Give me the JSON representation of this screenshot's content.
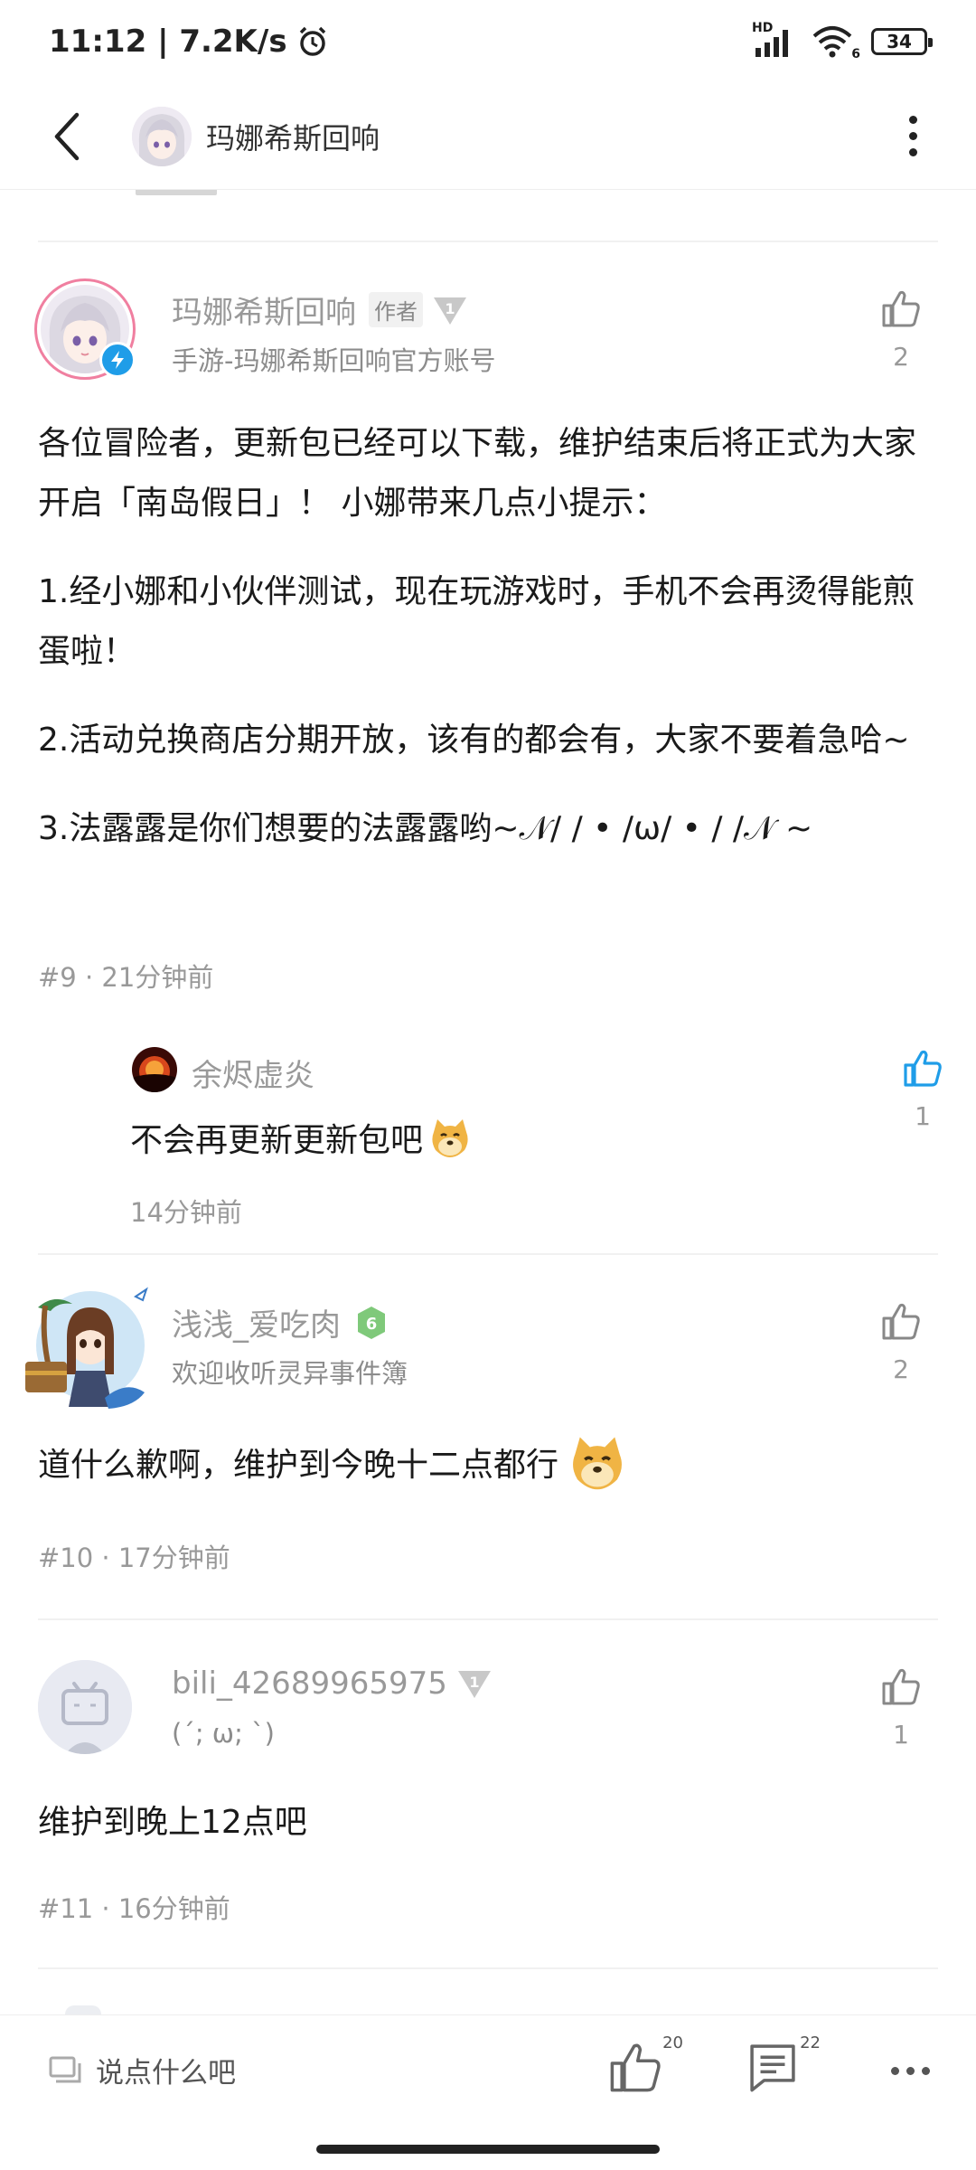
{
  "status_bar": {
    "time": "11:12 | 7.2K/s",
    "network": "HD",
    "wifi_sub": "6",
    "battery": "34"
  },
  "header": {
    "title": "玛娜希斯回响"
  },
  "partial_text": "",
  "comments": [
    {
      "username": "玛娜希斯回响",
      "author_badge": "作者",
      "level": "1",
      "subtitle": "手游-玛娜希斯回响官方账号",
      "likes": "2",
      "paragraphs": [
        "各位冒险者，更新包已经可以下载，维护结束后将正式为大家开启「南岛假日」！ 小娜带来几点小提示：",
        "1.经小娜和小伙伴测试，现在玩游戏时，手机不会再烫得能煎蛋啦！",
        "2.活动兑换商店分期开放，该有的都会有，大家不要着急哈~",
        "3.法露露是你们想要的法露露哟~𝒩/ / • /ω/ • / /𝒩 ~"
      ],
      "floor": "#9",
      "time": "21分钟前",
      "reply": {
        "username": "余烬虚炎",
        "text": "不会再更新更新包吧",
        "likes": "1",
        "time": "14分钟前"
      }
    },
    {
      "username": "浅浅_爱吃肉",
      "level": "6",
      "subtitle": "欢迎收听灵异事件簿",
      "likes": "2",
      "text": "道什么歉啊，维护到今晚十二点都行",
      "floor": "#10",
      "time": "17分钟前"
    },
    {
      "username": "bili_42689965975",
      "level": "1",
      "subtitle": "(´;  ω;  `)",
      "likes": "1",
      "text": "维护到晚上12点吧",
      "floor": "#11",
      "time": "16分钟前"
    }
  ],
  "bottom_bar": {
    "input_placeholder": "说点什么吧",
    "like_count": "20",
    "comment_count": "22"
  },
  "colors": {
    "accent_blue": "#1f9de8",
    "level6_green": "#7fc97a",
    "gray_text": "#999999"
  }
}
